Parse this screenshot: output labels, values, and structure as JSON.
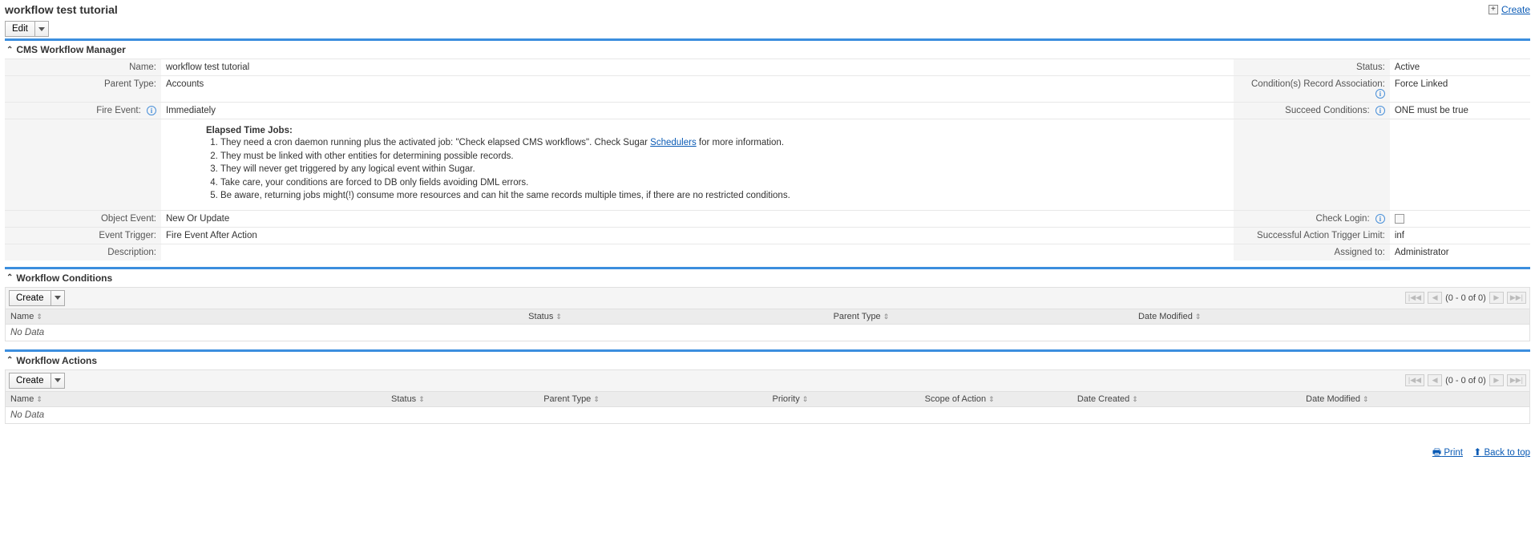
{
  "page": {
    "title": "workflow test tutorial",
    "create_link": "Create",
    "edit_label": "Edit"
  },
  "sections": {
    "manager": "CMS Workflow Manager",
    "conditions": "Workflow Conditions",
    "actions": "Workflow Actions"
  },
  "detail": {
    "name_label": "Name:",
    "name_value": "workflow test tutorial",
    "status_label": "Status:",
    "status_value": "Active",
    "parent_type_label": "Parent Type:",
    "parent_type_value": "Accounts",
    "cond_assoc_label": "Condition(s) Record Association:",
    "cond_assoc_value": "Force Linked",
    "fire_event_label": "Fire Event:",
    "fire_event_value": "Immediately",
    "succeed_cond_label": "Succeed Conditions:",
    "succeed_cond_value": "ONE must be true",
    "object_event_label": "Object Event:",
    "object_event_value": "New Or Update",
    "check_login_label": "Check Login:",
    "event_trigger_label": "Event Trigger:",
    "event_trigger_value": "Fire Event After Action",
    "action_limit_label": "Successful Action Trigger Limit:",
    "action_limit_value": "inf",
    "description_label": "Description:",
    "description_value": "",
    "assigned_label": "Assigned to:",
    "assigned_value": "Administrator"
  },
  "jobs": {
    "title": "Elapsed Time Jobs:",
    "item1_a": "They need a cron daemon running plus the activated job: \"Check elapsed CMS workflows\". Check Sugar ",
    "item1_link": "Schedulers",
    "item1_b": " for more information.",
    "item2": "They must be linked with other entities for determining possible records.",
    "item3": "They will never get triggered by any logical event within Sugar.",
    "item4": "Take care, your conditions are forced to DB only fields avoiding DML errors.",
    "item5": "Be aware, returning jobs might(!) consume more resources and can hit the same records multiple times, if there are no restricted conditions."
  },
  "subpanel": {
    "create_label": "Create",
    "pager_text": "(0 - 0 of 0)",
    "no_data": "No Data"
  },
  "cond_cols": {
    "name": "Name",
    "status": "Status",
    "parent_type": "Parent Type",
    "date_modified": "Date Modified"
  },
  "act_cols": {
    "name": "Name",
    "status": "Status",
    "parent_type": "Parent Type",
    "priority": "Priority",
    "scope": "Scope of Action",
    "date_created": "Date Created",
    "date_modified": "Date Modified"
  },
  "footer": {
    "print": " Print",
    "back": " Back to top"
  }
}
